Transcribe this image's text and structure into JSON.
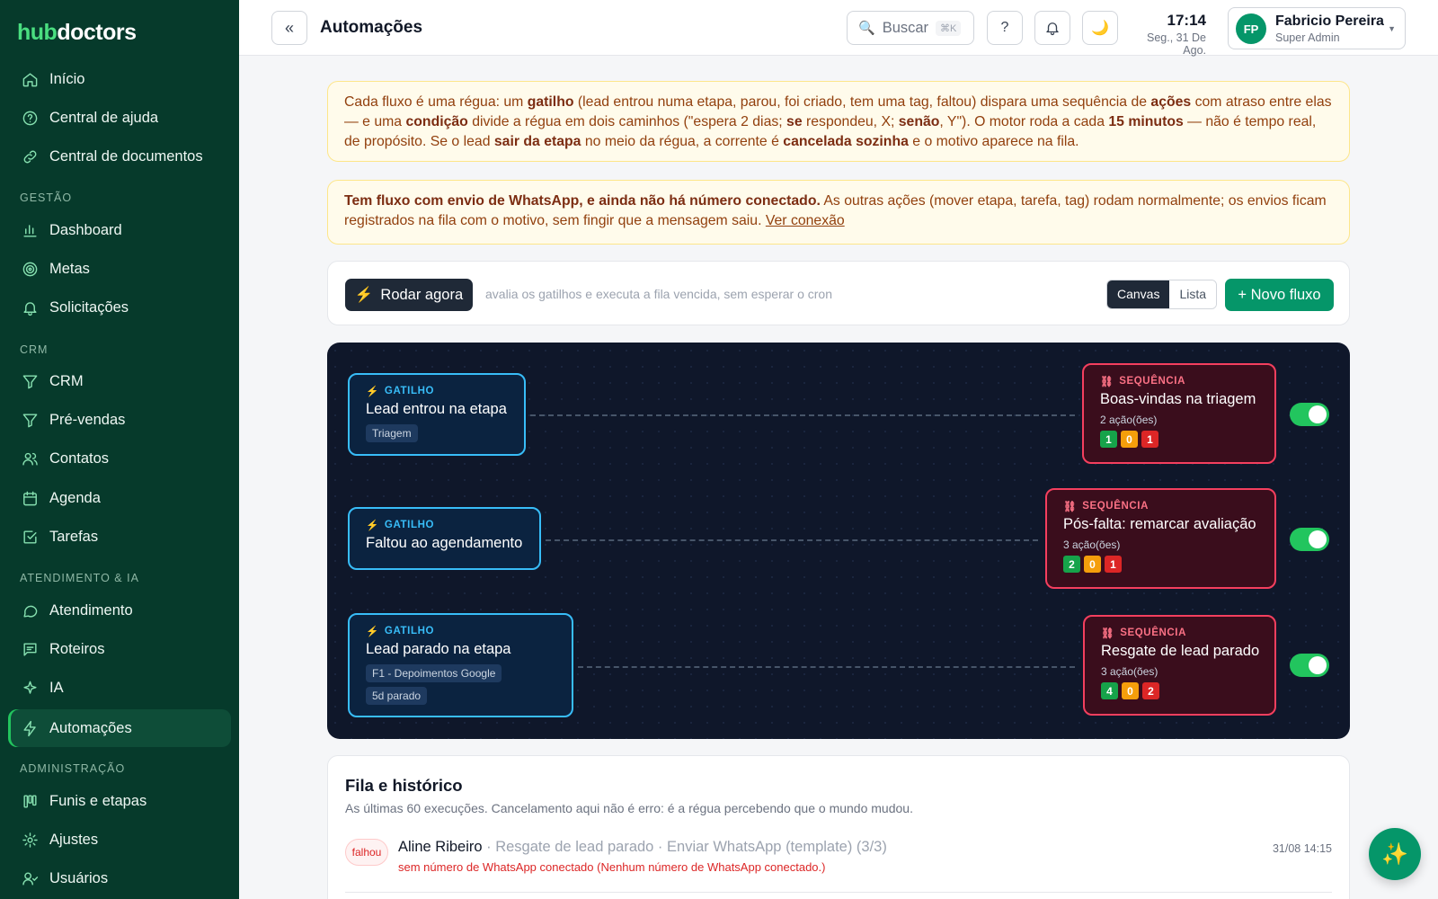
{
  "sidebar": {
    "logo_a": "hub",
    "logo_b": "doctors",
    "items": [
      {
        "label": "Início"
      },
      {
        "label": "Central de ajuda"
      },
      {
        "label": "Central de documentos"
      },
      {
        "label": "Dashboard"
      },
      {
        "label": "Metas"
      },
      {
        "label": "Solicitações"
      },
      {
        "label": "CRM"
      },
      {
        "label": "Pré-vendas"
      },
      {
        "label": "Contatos"
      },
      {
        "label": "Agenda"
      },
      {
        "label": "Tarefas"
      },
      {
        "label": "Atendimento"
      },
      {
        "label": "Roteiros"
      },
      {
        "label": "IA"
      },
      {
        "label": "Automações"
      },
      {
        "label": "Funis e etapas"
      },
      {
        "label": "Ajustes"
      },
      {
        "label": "Usuários"
      }
    ],
    "sections": [
      "GESTÃO",
      "CRM",
      "ATENDIMENTO & IA",
      "ADMINISTRAÇÃO"
    ]
  },
  "header": {
    "title": "Automações",
    "collapse_label": "«",
    "search_label": "Buscar",
    "search_kbd": "⌘K",
    "help_label": "?",
    "time": "17:14",
    "date": "Seg., 31 De Ago.",
    "user_initials": "FP",
    "user_name": "Fabricio Pereira",
    "user_role": "Super Admin"
  },
  "notice1": {
    "p1": "Cada fluxo é uma régua: um ",
    "b1": "gatilho",
    "p2": " (lead entrou numa etapa, parou, foi criado, tem uma tag, faltou) dispara uma sequência de ",
    "b2": "ações",
    "p3": " com atraso entre elas — e uma ",
    "b3": "condição",
    "p4": " divide a régua em dois caminhos (\"espera 2 dias; ",
    "b4": "se",
    "p5": " respondeu, X; ",
    "b5": "senão",
    "p6": ", Y\"). O motor roda a cada ",
    "b6": "15 minutos",
    "p7": " — não é tempo real, de propósito. Se o lead ",
    "b7": "sair da etapa",
    "p8": " no meio da régua, a corrente é ",
    "b8": "cancelada sozinha",
    "p9": " e o motivo aparece na fila."
  },
  "notice2": {
    "bold": "Tem fluxo com envio de WhatsApp, e ainda não há número conectado.",
    "text": " As outras ações (mover etapa, tarefa, tag) rodam normalmente; os envios ficam registrados na fila com o motivo, sem fingir que a mensagem saiu. ",
    "link": "Ver conexão"
  },
  "toolbar": {
    "run_label": "Rodar agora",
    "hint": "avalia os gatilhos e executa a fila vencida, sem esperar o cron",
    "view_canvas": "Canvas",
    "view_list": "Lista",
    "new_label": "+ Novo fluxo"
  },
  "flows": [
    {
      "trigger_kind": "GATILHO",
      "trigger_title": "Lead entrou na etapa",
      "trigger_chips": [
        "Triagem"
      ],
      "seq_kind": "SEQUÊNCIA",
      "seq_title": "Boas-vindas na triagem",
      "seq_actions": "2 ação(ões)",
      "counts": [
        "1",
        "0",
        "1"
      ],
      "enabled": true
    },
    {
      "trigger_kind": "GATILHO",
      "trigger_title": "Faltou ao agendamento",
      "trigger_chips": [],
      "seq_kind": "SEQUÊNCIA",
      "seq_title": "Pós-falta: remarcar avaliação",
      "seq_actions": "3 ação(ões)",
      "counts": [
        "2",
        "0",
        "1"
      ],
      "enabled": true
    },
    {
      "trigger_kind": "GATILHO",
      "trigger_title": "Lead parado na etapa",
      "trigger_chips": [
        "F1 - Depoimentos Google",
        "5d parado"
      ],
      "seq_kind": "SEQUÊNCIA",
      "seq_title": "Resgate de lead parado",
      "seq_actions": "3 ação(ões)",
      "counts": [
        "4",
        "0",
        "2"
      ],
      "enabled": true
    }
  ],
  "history": {
    "title": "Fila e histórico",
    "subtitle": "As últimas 60 execuções. Cancelamento aqui não é erro: é a régua percebendo que o mundo mudou.",
    "rows": [
      {
        "status": "falhou",
        "name": "Aline Ribeiro",
        "desc": " · Resgate de lead parado · Enviar WhatsApp (template) (3/3)",
        "error": "sem número de WhatsApp conectado (Nenhum número de WhatsApp conectado.)",
        "time": "31/08 14:15"
      }
    ]
  },
  "colors": {
    "sidebar_bg": "#063a2b",
    "accent": "#059669",
    "trigger_border": "#38bdf8",
    "sequence_border": "#f43f5e",
    "canvas_bg": "#0f172a"
  }
}
